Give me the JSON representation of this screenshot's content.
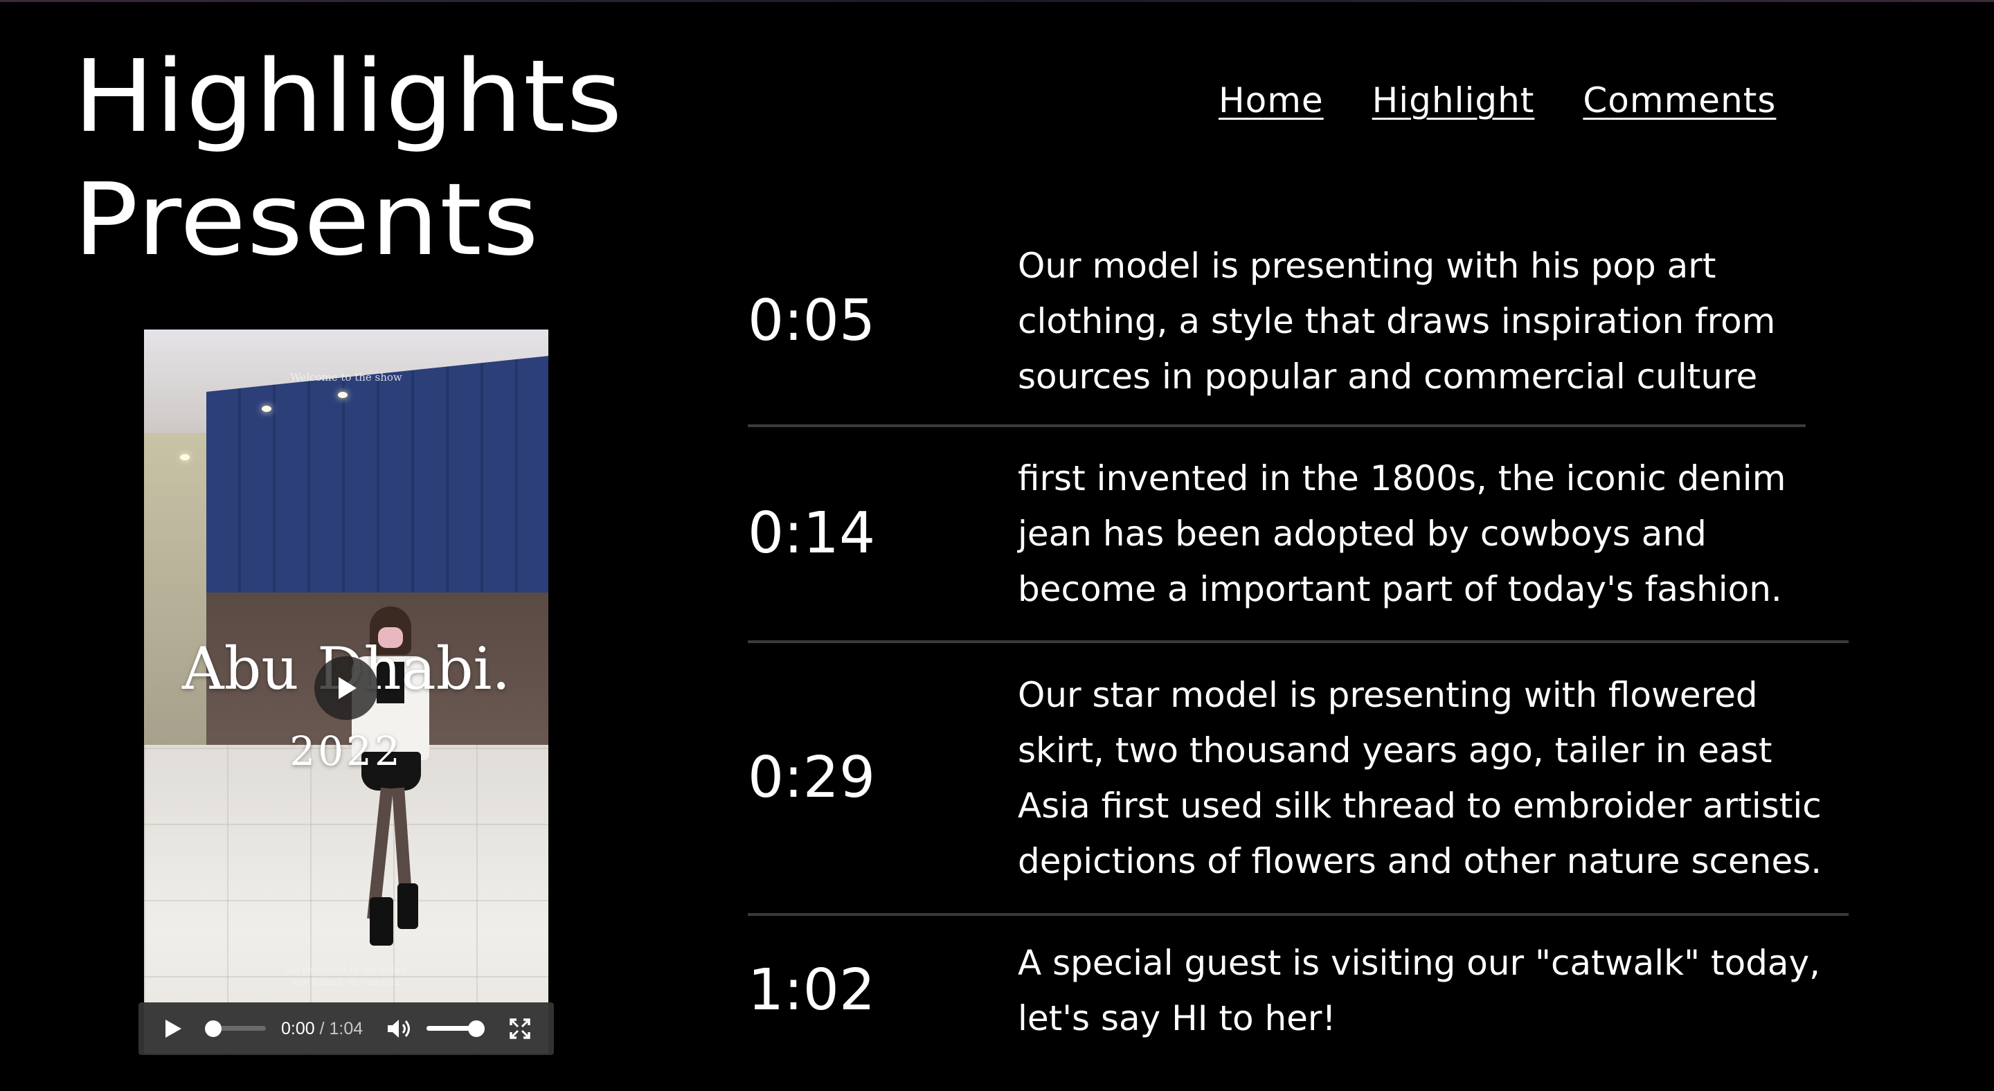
{
  "site": {
    "title_line1": "Highlights",
    "title_line2": "Presents"
  },
  "nav": {
    "items": [
      {
        "label": "Home"
      },
      {
        "label": "Highlight"
      },
      {
        "label": "Comments"
      }
    ]
  },
  "video": {
    "overlay_welcome": "Welcome to the show",
    "overlay_city": "Abu Dhabi.",
    "overlay_year": "2022",
    "overlay_footer_line1": "All recorded in my video",
    "overlay_footer_line2": "are filmed on campus",
    "current_time": "0:00",
    "separator": " / ",
    "duration": "1:04",
    "progress_fraction": 0.0,
    "volume_fraction": 1.0,
    "icons": [
      "play-icon",
      "volume-icon",
      "fullscreen-icon"
    ]
  },
  "highlights": [
    {
      "time": "0:05",
      "text": "Our model is presenting with his pop art\nclothing, a style that draws inspiration from\nsources in popular and commercial culture"
    },
    {
      "time": "0:14",
      "text": "first invented in the 1800s, the iconic denim\njean has been adopted by cowboys and\nbecome a important part of today's fashion."
    },
    {
      "time": "0:29",
      "text": "Our star model is presenting with flowered\nskirt, two thousand years ago, tailer in east\nAsia first used silk thread to embroider artistic\ndepictions of flowers and other nature scenes."
    },
    {
      "time": "1:02",
      "text": "A special guest is visiting our \"catwalk\" today,\nlet's say HI to her!"
    }
  ],
  "colors": {
    "background": "#000000",
    "text": "#ffffff",
    "divider": "#3a3a3a",
    "controls_bg": "#343434"
  }
}
